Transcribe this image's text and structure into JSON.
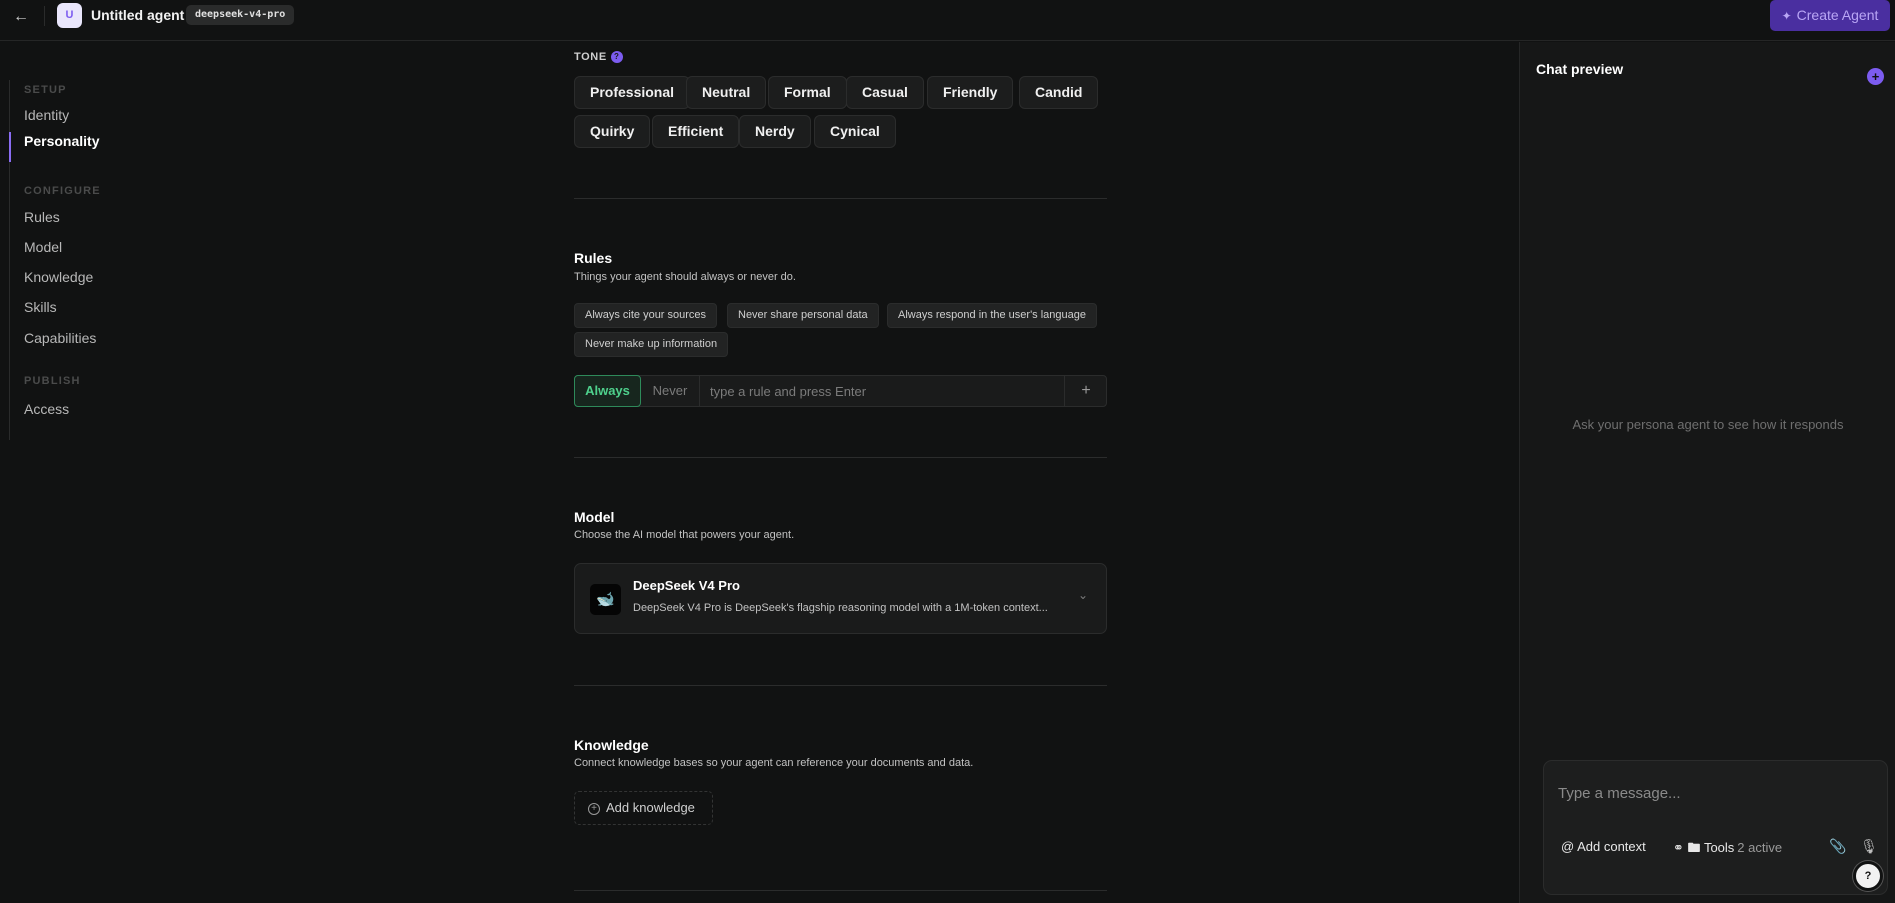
{
  "topbar": {
    "avatar_letter": "U",
    "agent_name": "Untitled agent",
    "model_badge": "deepseek-v4-pro",
    "create_label": "Create Agent"
  },
  "sidebar": {
    "groups": [
      {
        "label": "SETUP",
        "items": [
          "Identity",
          "Personality"
        ]
      },
      {
        "label": "CONFIGURE",
        "items": [
          "Rules",
          "Model",
          "Knowledge",
          "Skills",
          "Capabilities"
        ]
      },
      {
        "label": "PUBLISH",
        "items": [
          "Access"
        ]
      }
    ],
    "active": "Personality"
  },
  "tone": {
    "label": "TONE",
    "options": [
      "Professional",
      "Neutral",
      "Formal",
      "Casual",
      "Friendly",
      "Candid",
      "Quirky",
      "Efficient",
      "Nerdy",
      "Cynical"
    ]
  },
  "rules": {
    "title": "Rules",
    "subtitle": "Things your agent should always or never do.",
    "chips": [
      "Always cite your sources",
      "Never share personal data",
      "Always respond in the user's language",
      "Never make up information"
    ],
    "always_label": "Always",
    "never_label": "Never",
    "input_placeholder": "type a rule and press Enter",
    "add_symbol": "+"
  },
  "model": {
    "title": "Model",
    "subtitle": "Choose the AI model that powers your agent.",
    "selected_name": "DeepSeek V4 Pro",
    "selected_desc": "DeepSeek V4 Pro is DeepSeek's flagship reasoning model with a 1M-token context..."
  },
  "knowledge": {
    "title": "Knowledge",
    "subtitle": "Connect knowledge bases so your agent can reference your documents and data.",
    "add_label": "Add knowledge"
  },
  "chat": {
    "title": "Chat preview",
    "empty_text": "Ask your persona agent to see how it responds",
    "input_placeholder": "Type a message...",
    "add_context_label": "Add context",
    "tools_label": "Tools",
    "tools_active": "2 active"
  },
  "colors": {
    "accent": "#7c5cf0",
    "always_green": "#4ed08c",
    "background": "#111212"
  }
}
